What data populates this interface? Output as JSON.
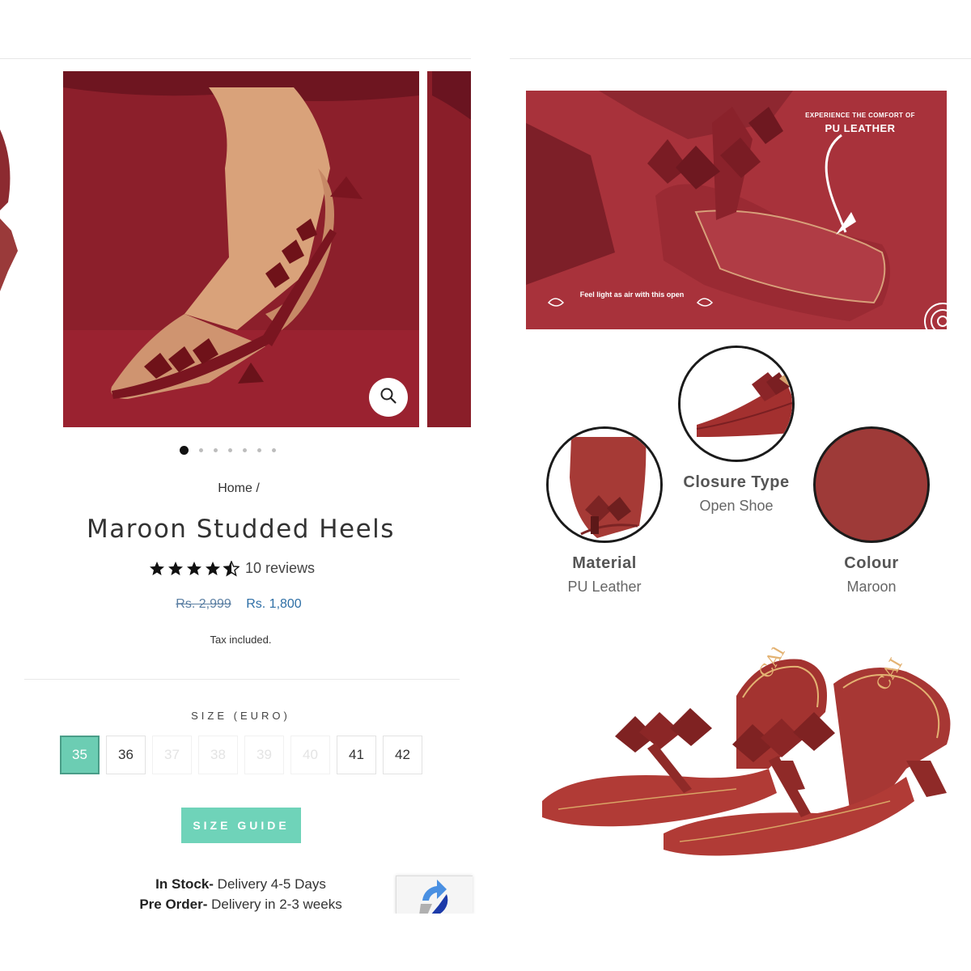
{
  "gallery": {
    "dots_count": 7,
    "active_dot": 0
  },
  "breadcrumb": {
    "home": "Home",
    "separator": "/"
  },
  "product": {
    "title": "Maroon Studded Heels",
    "rating": 4.5,
    "reviews": "10 reviews",
    "old_price": "Rs. 2,999",
    "price": "Rs. 1,800",
    "tax_note": "Tax included."
  },
  "size": {
    "label": "SIZE (EURO)",
    "options": [
      "35",
      "36",
      "37",
      "38",
      "39",
      "40",
      "41",
      "42"
    ],
    "selected": "35",
    "unavailable": [
      "37",
      "38",
      "39",
      "40"
    ]
  },
  "size_guide_label": "SIZE GUIDE",
  "availability": {
    "in_stock_label": "In Stock-",
    "in_stock_text": " Delivery 4-5 Days",
    "pre_order_label": "Pre Order-",
    "pre_order_text": " Delivery in 2-3 weeks"
  },
  "promo": {
    "line1": "EXPERIENCE THE COMFORT OF",
    "line2": "PU LEATHER",
    "caption": "Feel light as air with this open"
  },
  "features": {
    "material": {
      "label": "Material",
      "value": "PU Leather"
    },
    "closure": {
      "label": "Closure Type",
      "value": "Open Shoe"
    },
    "colour": {
      "label": "Colour",
      "value": "Maroon"
    }
  },
  "brand_mark": "CAI",
  "colors": {
    "maroon": "#9e2f35",
    "accent_teal": "#6fd3b9",
    "price_blue": "#2e6fa6"
  }
}
